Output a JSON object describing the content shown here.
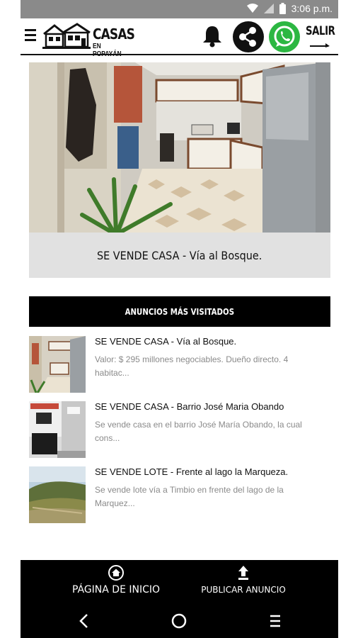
{
  "status_bar": {
    "time": "3:06 p.m."
  },
  "header": {
    "logo_title": "CASAS",
    "logo_subtitle": "EN POPAYÁN",
    "exit_label": "SALIR",
    "icons": [
      "menu-icon",
      "bell-icon",
      "share-icon",
      "whatsapp-icon",
      "exit-arrow-icon"
    ]
  },
  "hero": {
    "title": "SE VENDE CASA - Vía al Bosque."
  },
  "most_visited": {
    "heading": "ANUNCIOS MÁS VISITADOS",
    "items": [
      {
        "title": "SE VENDE CASA - Vía al Bosque.",
        "description": "Valor: $ 295 millones negociables. Dueño directo. 4 habitac..."
      },
      {
        "title": "SE VENDE CASA - Barrio José Maria Obando",
        "description": "Se vende casa en el barrio José María  Obando, la cual cons..."
      },
      {
        "title": "SE VENDE LOTE - Frente al lago la Marqueza.",
        "description": "Se vende lote vía a Timbio en frente del lago de la Marquez..."
      }
    ]
  },
  "bottom_nav": {
    "home_label": "PÁGINA DE INICIO",
    "publish_label": "PUBLICAR ANUNCIO"
  },
  "colors": {
    "whatsapp_green": "#2cb742",
    "status_bar": "#8a8a8a",
    "card_bg": "#e1e1e1"
  }
}
